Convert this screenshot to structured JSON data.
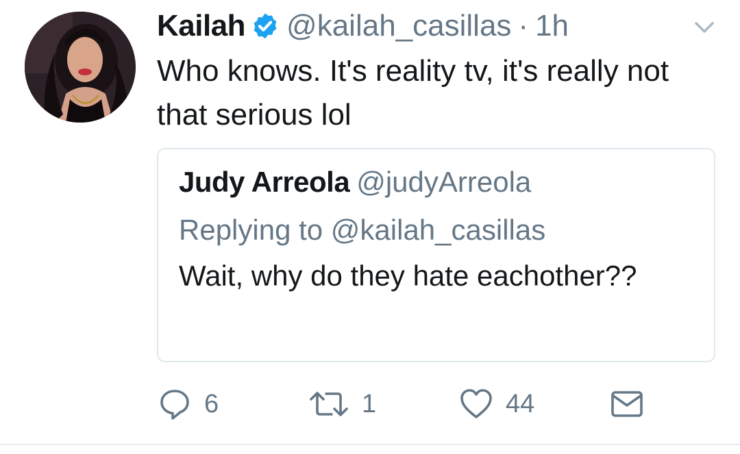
{
  "tweet": {
    "author_name": "Kailah",
    "author_handle": "@kailah_casillas",
    "separator": "·",
    "time": "1h",
    "verified": true,
    "text": "Who knows. It's reality tv, it's really not that serious lol"
  },
  "quoted_tweet": {
    "author_name": "Judy Arreola",
    "author_handle": "@judyArreola",
    "replying_to": "Replying to @kailah_casillas",
    "text": "Wait, why do they hate eachother??"
  },
  "actions": {
    "reply_count": "6",
    "retweet_count": "1",
    "like_count": "44"
  },
  "icons": {
    "verified": "verified-badge-icon",
    "menu": "chevron-down-icon",
    "reply": "reply-bubble-icon",
    "retweet": "retweet-icon",
    "like": "heart-icon",
    "dm": "envelope-icon"
  },
  "colors": {
    "verified_blue": "#1da1f2",
    "secondary_text": "#657786",
    "primary_text": "#14171a",
    "border": "#e1e8ed"
  }
}
